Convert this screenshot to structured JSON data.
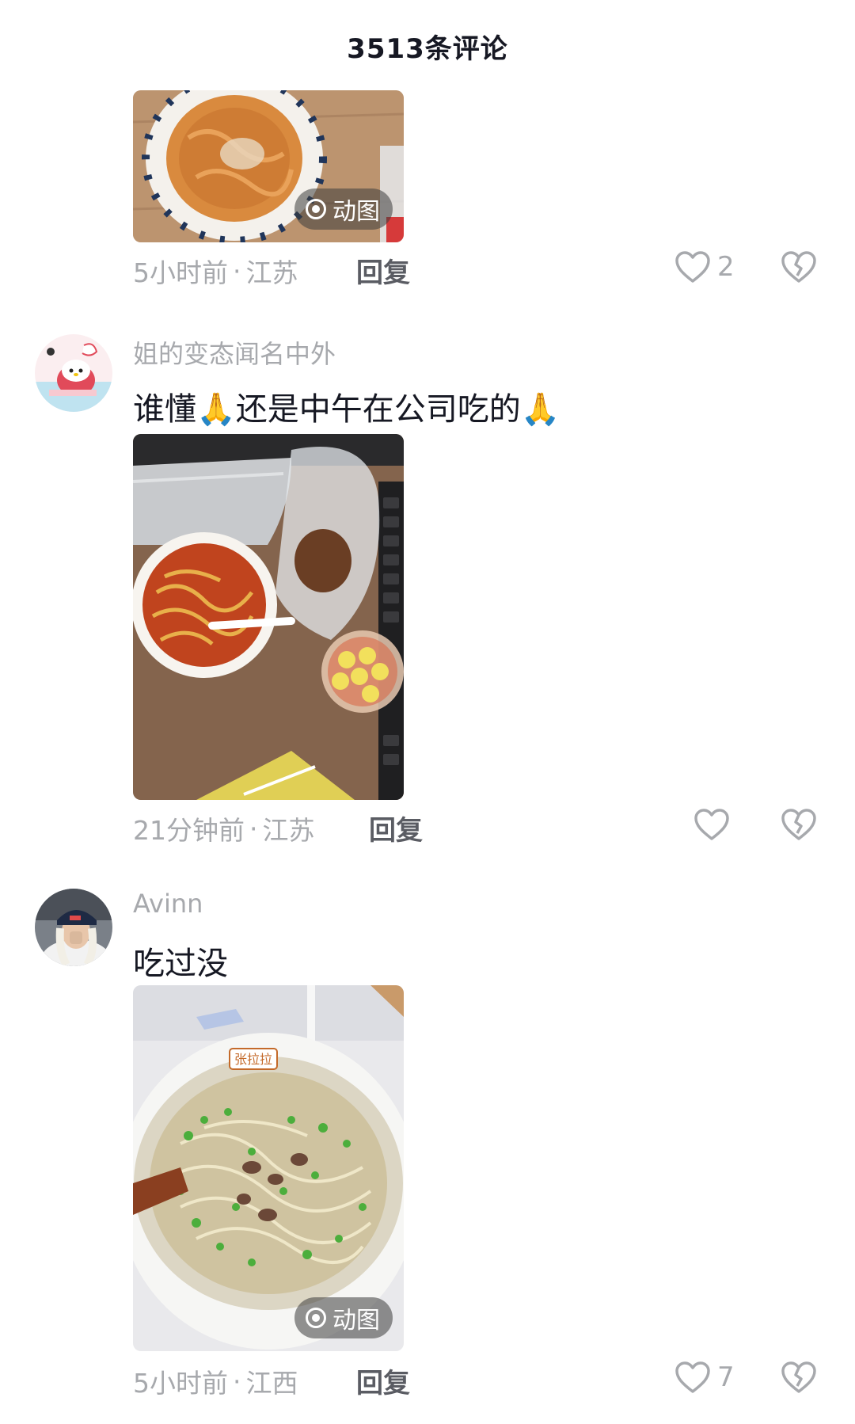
{
  "header": {
    "title": "3513条评论"
  },
  "comments": [
    {
      "media_badge": "动图",
      "time": "5小时前",
      "location": "江苏",
      "reply": "回复",
      "likes": "2"
    },
    {
      "username": "姐的变态闻名中外",
      "text": "谁懂🙏还是中午在公司吃的🙏",
      "time": "21分钟前",
      "location": "江苏",
      "reply": "回复",
      "likes": ""
    },
    {
      "username": "Avinn",
      "text": "吃过没",
      "media_badge": "动图",
      "time": "5小时前",
      "location": "江西",
      "reply": "回复",
      "likes": "7"
    }
  ],
  "image_labels": {
    "bowl_brand": "张拉拉"
  },
  "icons": {
    "like": "heart-outline-icon",
    "dislike": "broken-heart-icon",
    "gif": "gif-ring-icon"
  },
  "colors": {
    "secondary_text": "#a7a9ad",
    "primary_text": "#161823",
    "reply_text": "#5a5c63"
  }
}
